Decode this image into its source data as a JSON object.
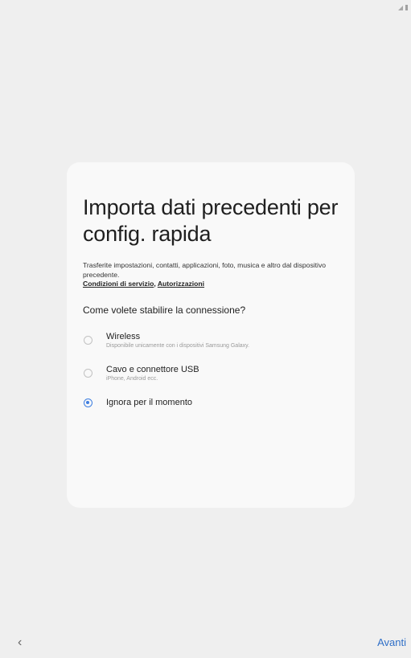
{
  "status_bar": {
    "signal_icon": "signal-icon",
    "battery_icon": "battery-icon"
  },
  "card": {
    "title": "Importa dati precedenti per config. rapida",
    "description": "Trasferite impostazioni, contatti, applicazioni, foto, musica e altro dal dispositivo precedente.",
    "links": {
      "terms": "Condizioni di servizio",
      "separator": ", ",
      "permissions": "Autorizzazioni"
    },
    "question": "Come volete stabilire la connessione?",
    "options": [
      {
        "label": "Wireless",
        "sublabel": "Disponibile unicamente con i dispositivi Samsung Galaxy.",
        "selected": false
      },
      {
        "label": "Cavo e connettore USB",
        "sublabel": "iPhone, Android ecc.",
        "selected": false
      },
      {
        "label": "Ignora per il momento",
        "sublabel": "",
        "selected": true
      }
    ]
  },
  "nav": {
    "back_label": "‹",
    "next_label": "Avanti"
  },
  "colors": {
    "accent": "#3e7ee0",
    "link": "#2f6fc7",
    "background": "#efefef",
    "card": "#f9f9f9"
  }
}
